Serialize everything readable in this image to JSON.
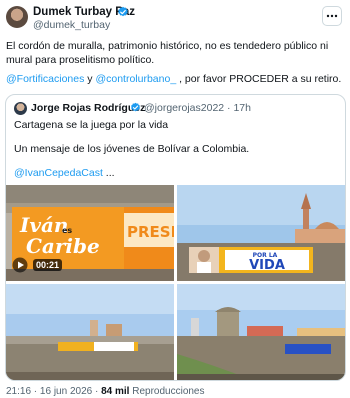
{
  "author": {
    "name": "Dumek Turbay Paz",
    "handle": "@dumek_turbay"
  },
  "tweet": {
    "text": "El cordón de muralla, patrimonio histórico, no es tendedero público ni mural para proselitismo político.",
    "mention1": "@Fortificaciones",
    "connector": " y ",
    "mention2": "@controlurbano_",
    "tail": " , por favor PROCEDER a su retiro."
  },
  "quote": {
    "name": "Jorge Rojas Rodríguez",
    "handle": "@jorgerojas2022",
    "separator": " · ",
    "time": "17h",
    "line1": "Cartagena se la juega por la vida",
    "line2": "Un mensaje de los jóvenes de Bolívar a Colombia.",
    "line3_link": "@IvanCepedaCast",
    "line3_tail": " ..."
  },
  "media": {
    "video_duration": "00:21",
    "banner1_text_a": "Iván",
    "banner1_text_b": "es",
    "banner1_text_c": "Caribe",
    "banner1_text_d": "PRESI",
    "banner2_text_a": "POR LA",
    "banner2_text_b": "VIDA"
  },
  "footer": {
    "time": "21:16",
    "dot": " · ",
    "date": "16 jun 2026",
    "views_count": "84 mil",
    "views_label": " Reproducciones"
  },
  "colors": {
    "link": "#1d9bf0",
    "verified": "#1d9bf0",
    "secondary_text": "#536471"
  }
}
